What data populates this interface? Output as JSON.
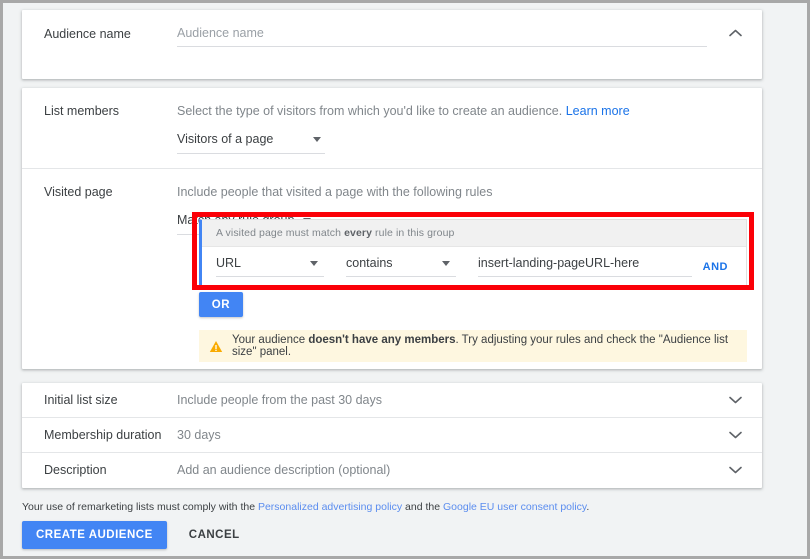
{
  "audience_name": {
    "label": "Audience name",
    "placeholder": "Audience name",
    "value": "",
    "collapse_icon": "chevron-up-icon"
  },
  "list_members": {
    "label": "List members",
    "description": "Select the type of visitors from which you'd like to create an audience.",
    "learn_more": "Learn more",
    "selected": "Visitors of a page"
  },
  "visited_page": {
    "label": "Visited page",
    "description": "Include people that visited a page with the following rules",
    "match_selected": "Match any rule group",
    "rule_group": {
      "header_prefix": "A visited page must match ",
      "header_bold": "every",
      "header_suffix": " rule in this group",
      "dimension": "URL",
      "operator": "contains",
      "value": "insert-landing-pageURL-here",
      "and_label": "AND"
    },
    "or_label": "OR",
    "warning": {
      "icon": "warning-triangle-icon",
      "prefix": "Your audience ",
      "bold": "doesn't have any members",
      "suffix": ". Try adjusting your rules and check the \"Audience list size\" panel."
    }
  },
  "extra_rows": [
    {
      "label": "Initial list size",
      "value": "Include people from the past 30 days",
      "icon": "chevron-down-icon"
    },
    {
      "label": "Membership duration",
      "value": "30 days",
      "icon": "chevron-down-icon"
    },
    {
      "label": "Description",
      "value": "Add an audience description (optional)",
      "icon": "chevron-down-icon"
    }
  ],
  "footer": {
    "note_prefix": "Your use of remarketing lists must comply with the ",
    "link_1": "Personalized advertising policy",
    "note_middle": " and the ",
    "link_2": "Google EU user consent policy",
    "note_suffix": ".",
    "create_label": "CREATE AUDIENCE",
    "cancel_label": "CANCEL"
  },
  "colors": {
    "accent_blue": "#4285f4",
    "link_blue": "#1a73e8",
    "highlight_red": "#fb0007",
    "warning_bg": "#fef7e0",
    "warning_icon": "#f9ab00",
    "page_bg": "#f1f3f4"
  }
}
